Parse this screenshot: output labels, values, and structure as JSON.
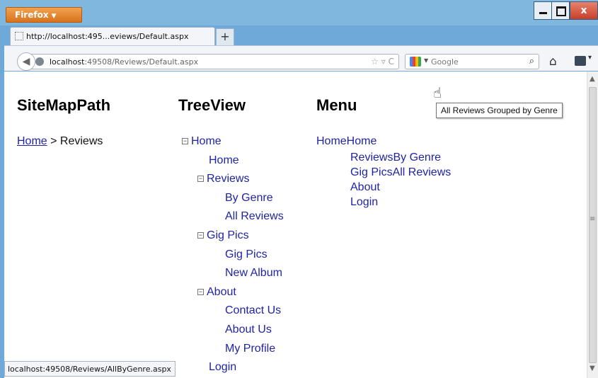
{
  "browser": {
    "menu_button": "Firefox",
    "tab_title": "http://localhost:495...eviews/Default.aspx",
    "new_tab": "+",
    "url_host": "localhost",
    "url_path": ":49508/Reviews/Default.aspx",
    "search_placeholder": "Google",
    "close_glyph": "x",
    "status_url": "localhost:49508/Reviews/AllByGenre.aspx"
  },
  "page": {
    "sitemap_title": "SiteMapPath",
    "treeview_title": "TreeView",
    "menu_title": "Menu",
    "breadcrumb": {
      "home": "Home",
      "separator": " > ",
      "current": "Reviews"
    },
    "tree": [
      {
        "label": "Home",
        "level": 0,
        "expandable": true
      },
      {
        "label": "Home",
        "level": 1,
        "expandable": false
      },
      {
        "label": "Reviews",
        "level": 1,
        "expandable": true
      },
      {
        "label": "By Genre",
        "level": 2,
        "expandable": false
      },
      {
        "label": "All Reviews",
        "level": 2,
        "expandable": false
      },
      {
        "label": "Gig Pics",
        "level": 1,
        "expandable": true
      },
      {
        "label": "Gig Pics",
        "level": 2,
        "expandable": false
      },
      {
        "label": "New Album",
        "level": 2,
        "expandable": false
      },
      {
        "label": "About",
        "level": 1,
        "expandable": true
      },
      {
        "label": "Contact Us",
        "level": 2,
        "expandable": false
      },
      {
        "label": "About Us",
        "level": 2,
        "expandable": false
      },
      {
        "label": "My Profile",
        "level": 2,
        "expandable": false
      },
      {
        "label": "Login",
        "level": 1,
        "expandable": false
      }
    ],
    "menu": {
      "root": "HomeHome",
      "items": [
        "ReviewsBy Genre",
        "Gig PicsAll Reviews",
        "About",
        "Login"
      ]
    },
    "tooltip": "All Reviews Grouped by Genre"
  }
}
